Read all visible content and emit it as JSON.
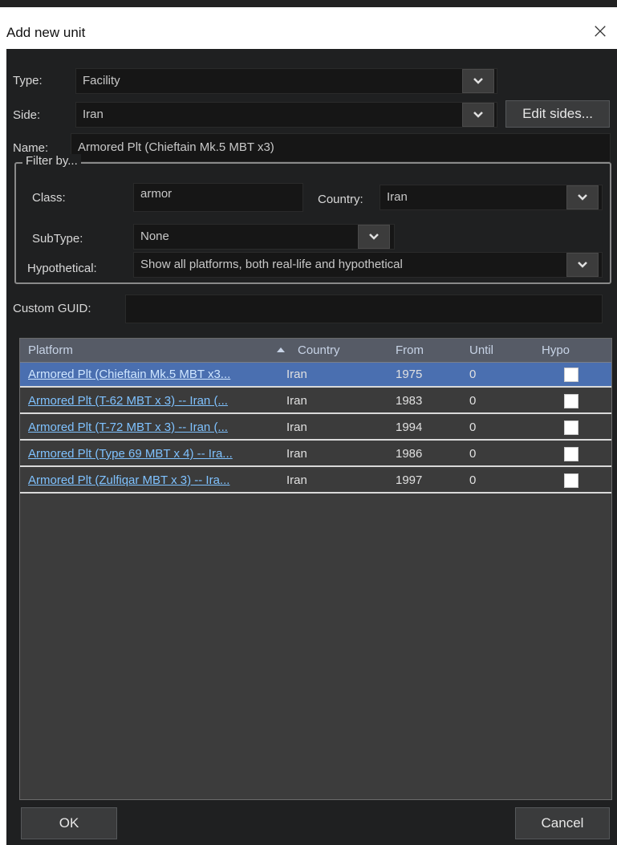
{
  "window": {
    "title": "Add new unit"
  },
  "form": {
    "type_label": "Type:",
    "type_value": "Facility",
    "side_label": "Side:",
    "side_value": "Iran",
    "edit_sides_label": "Edit sides...",
    "name_label": "Name:",
    "name_value": "Armored Plt (Chieftain Mk.5 MBT x3)",
    "filter_title": "Filter by...",
    "class_label": "Class:",
    "class_value": "armor",
    "country_label": "Country:",
    "country_value": "Iran",
    "subtype_label": "SubType:",
    "subtype_value": "None",
    "hypothetical_label": "Hypothetical:",
    "hypothetical_value": "Show all platforms, both real-life and hypothetical",
    "guid_label": "Custom GUID:",
    "guid_value": ""
  },
  "table": {
    "columns": [
      "Platform",
      "Country",
      "From",
      "Until",
      "Hypo"
    ],
    "rows": [
      {
        "platform": "Armored Plt (Chieftain Mk.5 MBT x3...",
        "country": "Iran",
        "from": "1975",
        "until": "0",
        "hypo": false
      },
      {
        "platform": "Armored Plt (T-62 MBT x 3) -- Iran (...",
        "country": "Iran",
        "from": "1983",
        "until": "0",
        "hypo": false
      },
      {
        "platform": "Armored Plt (T-72 MBT x 3) -- Iran (...",
        "country": "Iran",
        "from": "1994",
        "until": "0",
        "hypo": false
      },
      {
        "platform": "Armored Plt (Type 69 MBT x 4) -- Ira...",
        "country": "Iran",
        "from": "1986",
        "until": "0",
        "hypo": false
      },
      {
        "platform": "Armored Plt (Zulfiqar MBT x 3) -- Ira...",
        "country": "Iran",
        "from": "1997",
        "until": "0",
        "hypo": false
      }
    ]
  },
  "buttons": {
    "ok": "OK",
    "cancel": "Cancel"
  },
  "colors": {
    "background": "#1f2021",
    "selected_row": "#4a6fb0",
    "link": "#7fc2ff",
    "header": "#565b66"
  }
}
